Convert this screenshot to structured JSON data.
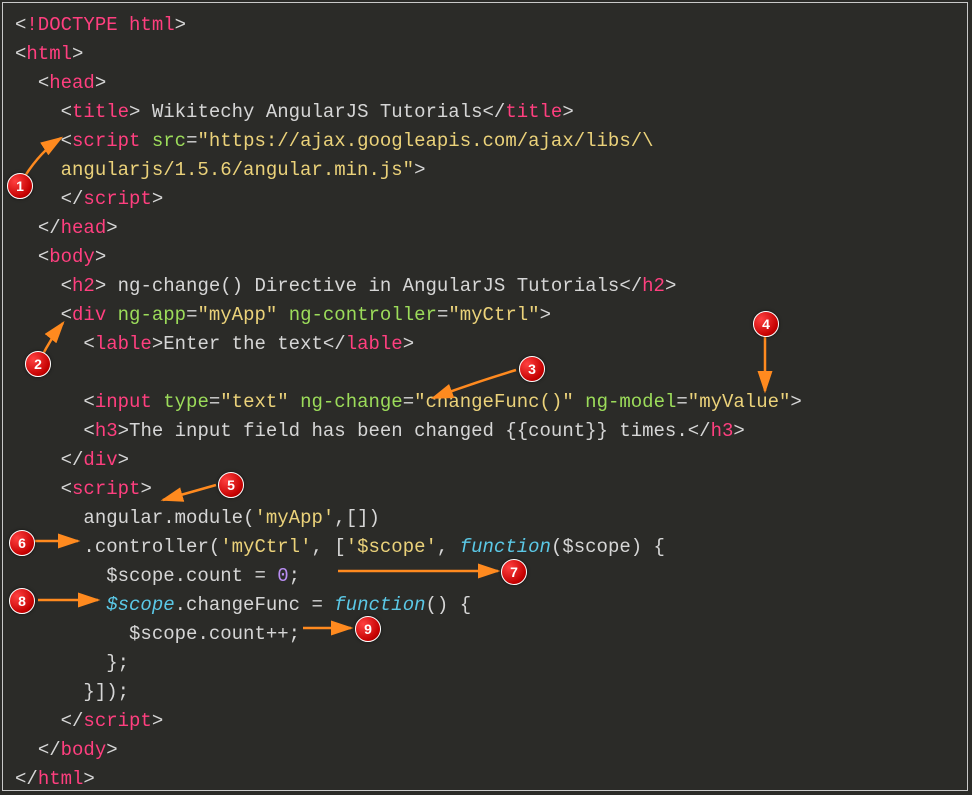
{
  "code": {
    "l1": {
      "doctype": "!DOCTYPE html"
    },
    "l2": {
      "open": "html"
    },
    "l3": {
      "open": "head"
    },
    "l4": {
      "open": "title",
      "text": " Wikitechy AngularJS Tutorials",
      "close": "title"
    },
    "l5": {
      "open": "script",
      "a1n": "src",
      "a1v": "\"https://ajax.googleapis.com/ajax/libs/\\"
    },
    "l6": {
      "cont": "angularjs/1.5.6/angular.min.js\"",
      "end": ">"
    },
    "l7": {
      "close": "script"
    },
    "l8": {
      "close": "head"
    },
    "l9": {
      "open": "body"
    },
    "l10": {
      "open": "h2",
      "text": " ng-change() Directive in AngularJS Tutorials",
      "close": "h2"
    },
    "l11": {
      "open": "div",
      "a1n": "ng-app",
      "a1v": "\"myApp\"",
      "a2n": "ng-controller",
      "a2v": "\"myCtrl\""
    },
    "l12": {
      "open": "lable",
      "text": "Enter the text",
      "close": "lable"
    },
    "l14": {
      "open": "input",
      "a1n": "type",
      "a1v": "\"text\"",
      "a2n": "ng-change",
      "a2v": "\"changeFunc()\"",
      "a3n": "ng-model",
      "a3v": "\"myValue\""
    },
    "l15": {
      "open": "h3",
      "text": "The input field has been changed {{count}} times.",
      "close": "h3"
    },
    "l16": {
      "close": "div"
    },
    "l17": {
      "open": "script"
    },
    "l18": {
      "a": "angular",
      "b": ".module(",
      "c": "'myApp'",
      "d": ",[])"
    },
    "l19": {
      "a": ".controller(",
      "b": "'myCtrl'",
      "c": ", [",
      "d": "'$scope'",
      "e": ", ",
      "f": "function",
      "g": "($scope) {"
    },
    "l20": {
      "a": "$scope.count = ",
      "b": "0",
      "c": ";"
    },
    "l21": {
      "a": "$scope",
      "b": ".changeFunc = ",
      "c": "function",
      "d": "() {"
    },
    "l22": {
      "a": "$scope.count++;"
    },
    "l23": {
      "a": "};"
    },
    "l24": {
      "a": "}]);"
    },
    "l25": {
      "close": "script"
    },
    "l26": {
      "close": "body"
    },
    "l27": {
      "close": "html"
    }
  },
  "badges": {
    "b1": "1",
    "b2": "2",
    "b3": "3",
    "b4": "4",
    "b5": "5",
    "b6": "6",
    "b7": "7",
    "b8": "8",
    "b9": "9"
  }
}
